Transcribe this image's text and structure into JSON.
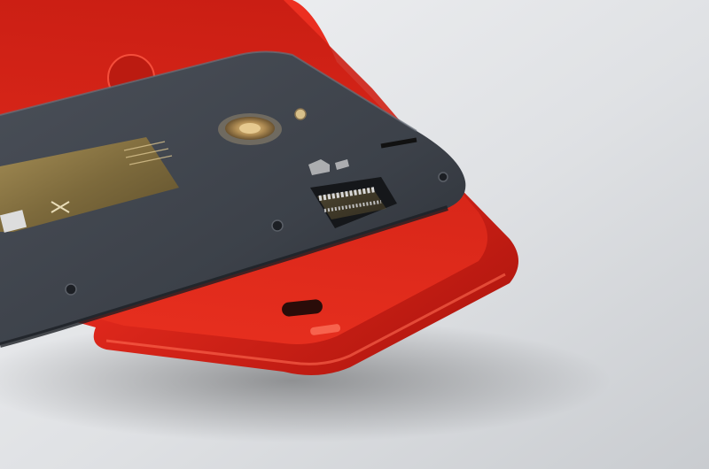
{
  "scene": {
    "subject": "smartphone-back-with-removed-red-cover",
    "colors": {
      "surface_light": "#eceef1",
      "surface_shadow": "#b9bcc1",
      "cover_red": "#e0281c",
      "cover_red_dark": "#a8130c",
      "cover_red_light": "#ff4a36",
      "phone_body": "#3e434b",
      "phone_body_dark": "#24282e",
      "label_gold": "#8f7a45",
      "camera_ring": "#c9a872",
      "sim_metal": "#c8c8c8"
    },
    "icons": [
      "camera-lens-icon",
      "flash-led-icon",
      "sim-card-icon",
      "microsd-card-icon"
    ]
  }
}
